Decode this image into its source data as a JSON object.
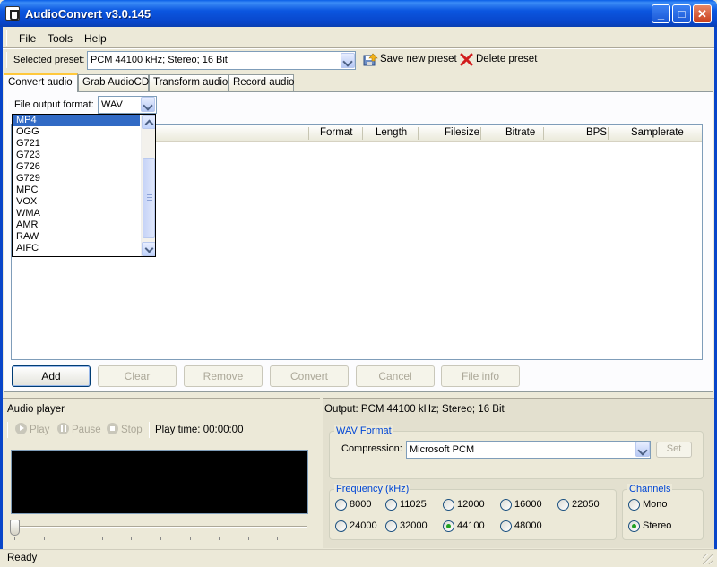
{
  "window": {
    "title": "AudioConvert v3.0.145",
    "minimize_glyph": "_",
    "maximize_glyph": "□",
    "close_glyph": "✕"
  },
  "menu": {
    "file": "File",
    "tools": "Tools",
    "help": "Help"
  },
  "preset": {
    "label": "Selected preset:",
    "value": "PCM 44100 kHz; Stereo; 16 Bit",
    "save_label": "Save new preset",
    "delete_label": "Delete preset"
  },
  "tabs": [
    {
      "label": "Convert audio",
      "active": true
    },
    {
      "label": "Grab AudioCD",
      "active": false
    },
    {
      "label": "Transform audio",
      "active": false
    },
    {
      "label": "Record audio",
      "active": false
    }
  ],
  "output_format": {
    "label": "File output format:",
    "value": "WAV",
    "options": [
      "MP4",
      "OGG",
      "G721",
      "G723",
      "G726",
      "G729",
      "MPC",
      "VOX",
      "WMA",
      "AMR",
      "RAW",
      "AIFC"
    ],
    "highlighted": "MP4"
  },
  "file_list": {
    "columns": [
      "Format",
      "Length",
      "Filesize",
      "Bitrate",
      "BPS",
      "Samplerate"
    ],
    "rows": []
  },
  "actions": {
    "add": "Add",
    "clear": "Clear",
    "remove": "Remove",
    "convert": "Convert",
    "cancel": "Cancel",
    "file_info": "File info"
  },
  "player": {
    "title": "Audio player",
    "play": "Play",
    "pause": "Pause",
    "stop": "Stop",
    "play_time_label": "Play time:",
    "play_time": "00:00:00",
    "position": 0
  },
  "output": {
    "summary": "Output: PCM 44100 kHz; Stereo; 16 Bit",
    "wav_group_title": "WAV Format",
    "compression_label": "Compression:",
    "compression_value": "Microsoft PCM",
    "set_label": "Set",
    "frequency_title": "Frequency (kHz)",
    "frequencies": [
      "8000",
      "11025",
      "12000",
      "16000",
      "22050",
      "24000",
      "32000",
      "44100",
      "48000"
    ],
    "selected_frequency": "44100",
    "channels_title": "Channels",
    "channels": [
      "Mono",
      "Stereo"
    ],
    "selected_channel": "Stereo"
  },
  "status": {
    "text": "Ready"
  },
  "colors": {
    "title_bar": "#0845c9",
    "selection": "#316ac5",
    "group_title": "#0046d5",
    "disabled_text": "#aca899"
  }
}
